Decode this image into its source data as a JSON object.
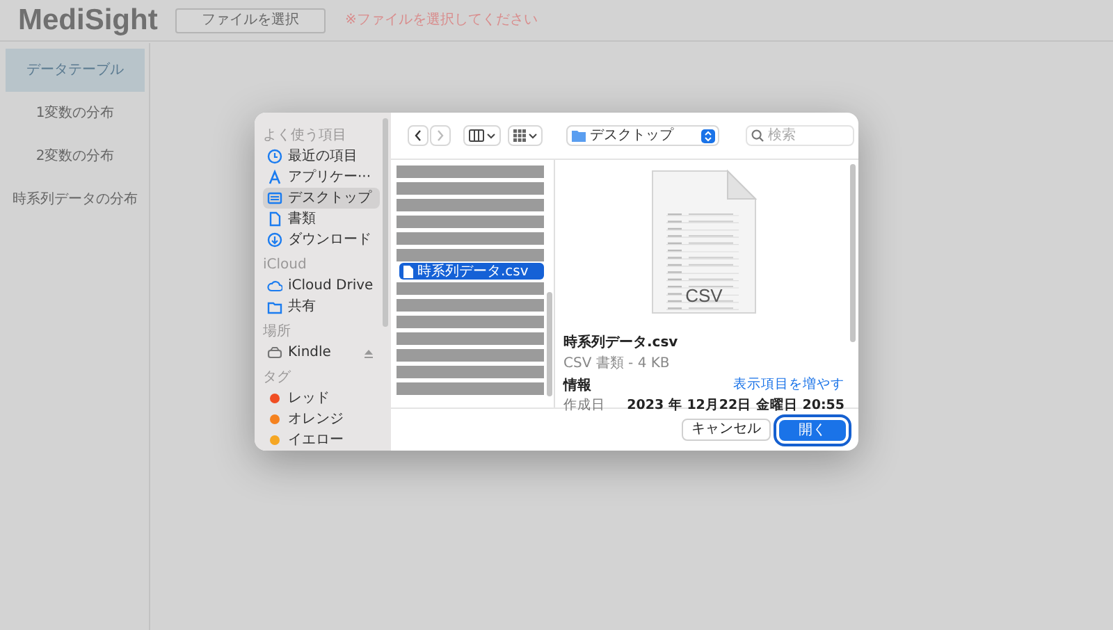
{
  "app": {
    "title": "MediSight",
    "file_button": "ファイルを選択",
    "file_warning": "※ファイルを選択してください"
  },
  "nav": [
    {
      "label": "データテーブル",
      "selected": true
    },
    {
      "label": "1変数の分布",
      "selected": false
    },
    {
      "label": "2変数の分布",
      "selected": false
    },
    {
      "label": "時系列データの分布",
      "selected": false
    }
  ],
  "dialog": {
    "sidebar": [
      {
        "heading": "よく使う項目",
        "items": [
          {
            "label": "最近の項目",
            "kind": "clock",
            "selected": false
          },
          {
            "label": "アプリケー···",
            "kind": "apps",
            "selected": false
          },
          {
            "label": "デスクトップ",
            "kind": "desktop",
            "selected": true
          },
          {
            "label": "書類",
            "kind": "document",
            "selected": false
          },
          {
            "label": "ダウンロード",
            "kind": "download",
            "selected": false
          }
        ]
      },
      {
        "heading": "iCloud",
        "items": [
          {
            "label": "iCloud Drive",
            "kind": "cloud",
            "selected": false
          },
          {
            "label": "共有",
            "kind": "shared",
            "selected": false
          }
        ]
      },
      {
        "heading": "場所",
        "items": [
          {
            "label": "Kindle",
            "kind": "drive",
            "selected": false
          }
        ]
      },
      {
        "heading": "タグ",
        "items": [
          {
            "label": "レッド",
            "kind": "tag",
            "color": "#f04e23",
            "selected": false
          },
          {
            "label": "オレンジ",
            "kind": "tag",
            "color": "#f5821f",
            "selected": false
          },
          {
            "label": "イエロー",
            "kind": "tag",
            "color": "#f5a623",
            "selected": false
          }
        ]
      }
    ],
    "toolbar": {
      "location": "デスクトップ",
      "search_placeholder": "検索"
    },
    "files": [
      {
        "kind": "redacted",
        "selected": false
      },
      {
        "kind": "redacted",
        "selected": false
      },
      {
        "kind": "redacted",
        "selected": false
      },
      {
        "kind": "redacted",
        "selected": false
      },
      {
        "kind": "redacted",
        "selected": false
      },
      {
        "kind": "redacted",
        "selected": false
      },
      {
        "kind": "file",
        "name": "時系列データ.csv",
        "selected": true
      },
      {
        "kind": "redacted",
        "selected": false
      },
      {
        "kind": "redacted",
        "selected": false
      },
      {
        "kind": "redacted",
        "selected": false
      },
      {
        "kind": "redacted",
        "selected": false
      },
      {
        "kind": "redacted",
        "selected": false
      },
      {
        "kind": "redacted",
        "selected": false
      },
      {
        "kind": "redacted",
        "selected": false
      }
    ],
    "preview": {
      "icon_label": "CSV",
      "name": "時系列データ.csv",
      "subtitle": "CSV 書類 - 4 KB",
      "info_heading": "情報",
      "more_link": "表示項目を増やす",
      "fields": [
        {
          "label": "作成日",
          "value": "2023 年 12月22日 金曜日 20:55"
        }
      ]
    },
    "buttons": {
      "cancel": "キャンセル",
      "open": "開く"
    }
  }
}
